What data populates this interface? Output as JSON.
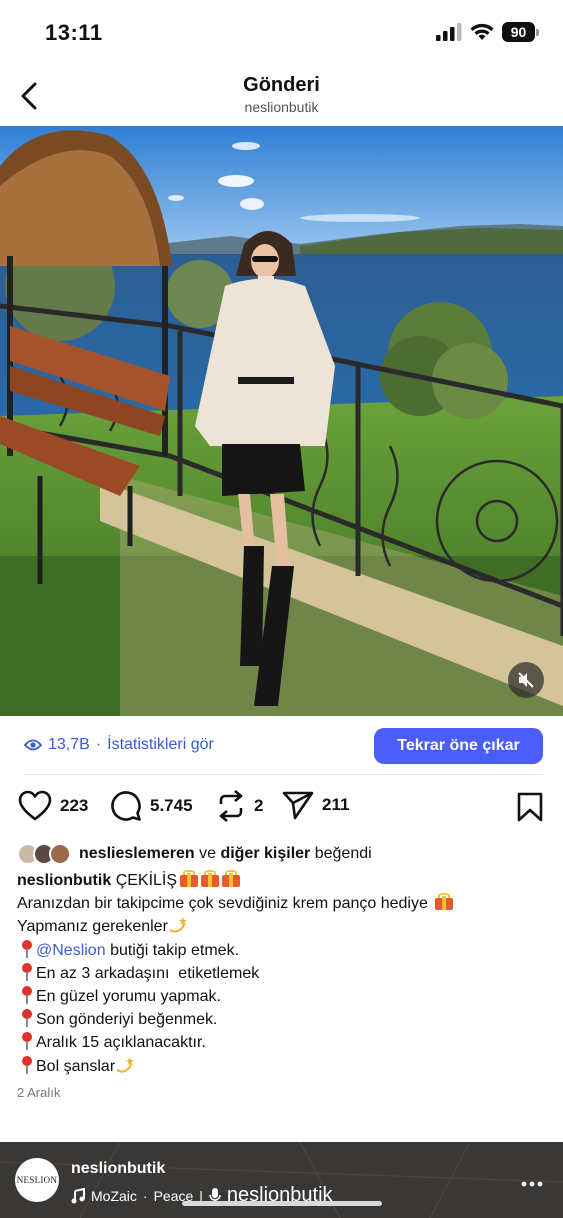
{
  "status_bar": {
    "time": "13:11",
    "battery": "90"
  },
  "header": {
    "back_icon": "chevron-left-icon",
    "title": "Gönderi",
    "subtitle": "neslionbutik"
  },
  "media": {
    "mute_icon": "speaker-muted-icon"
  },
  "insights": {
    "views": "13,7B",
    "separator": "·",
    "link_label": "İstatistikleri gör",
    "boost_label": "Tekrar öne çıkar",
    "accent_color": "#4a5df9"
  },
  "actions": {
    "likes": "223",
    "comments": "5.745",
    "reposts": "2",
    "shares": "211"
  },
  "liked_by": {
    "user": "neslieslemeren",
    "connector": "ve",
    "others": "diğer kişiler",
    "suffix": "beğendi"
  },
  "caption": {
    "username": "neslionbutik",
    "title": "ÇEKİLİŞ",
    "line1": "Aranızdan bir takipcime çok sevdiğiniz krem panço hediye",
    "line2": "Yapmanız gerekenler",
    "mention": "@Neslion",
    "item1_rest": "butiği takip etmek.",
    "item2": "En az 3 arkadaşını  etiketlemek",
    "item3": "En güzel yorumu yapmak.",
    "item4": "Son gönderiyi beğenmek.",
    "item5": "Aralık 15 açıklanacaktır.",
    "item6": "Bol şanslar"
  },
  "date": "2 Aralık",
  "now_playing": {
    "username": "neslionbutik",
    "avatar_text": "NESLION",
    "artist": "MoZaic",
    "separator": "·",
    "track": "Peace",
    "divider": "|",
    "audio_owner": "neslionbutik"
  }
}
